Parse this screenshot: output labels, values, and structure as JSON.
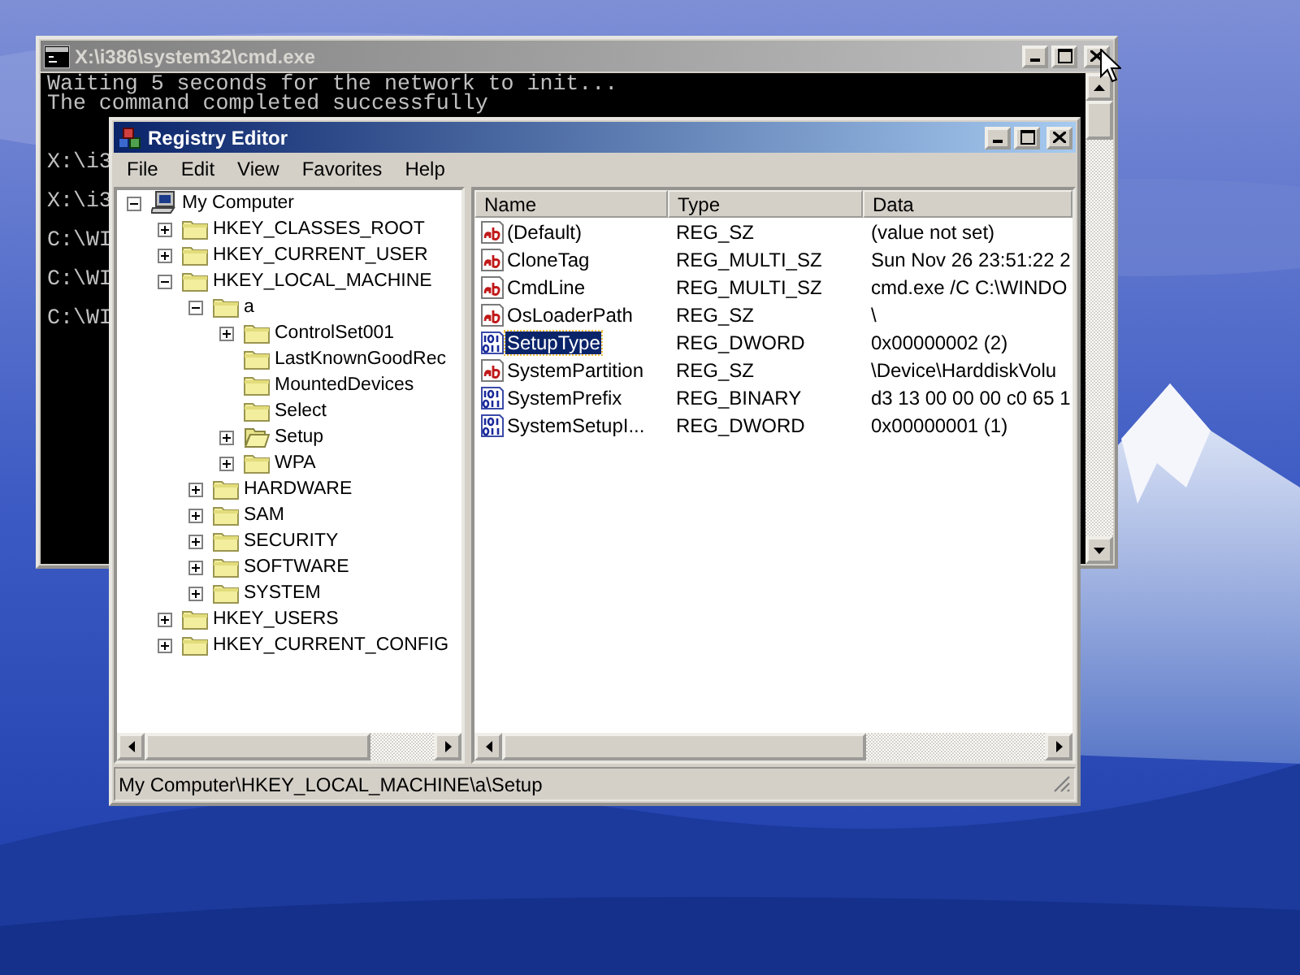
{
  "console_window": {
    "title": "X:\\i386\\system32\\cmd.exe",
    "lines": [
      "Waiting 5 seconds for the network to init...",
      "The command completed successfully",
      "X:\\i3",
      "X:\\i3",
      "C:\\WI",
      "C:\\WI",
      "C:\\WI"
    ]
  },
  "registry_editor": {
    "title": "Registry Editor",
    "menu": [
      "File",
      "Edit",
      "View",
      "Favorites",
      "Help"
    ],
    "tree": [
      {
        "label": "My Computer",
        "kind": "computer",
        "expanded": true,
        "selected": false,
        "children": [
          {
            "label": "HKEY_CLASSES_ROOT",
            "kind": "branch",
            "expanded": false,
            "selected": false
          },
          {
            "label": "HKEY_CURRENT_USER",
            "kind": "branch",
            "expanded": false,
            "selected": false
          },
          {
            "label": "HKEY_LOCAL_MACHINE",
            "kind": "branch",
            "expanded": true,
            "selected": false,
            "children": [
              {
                "label": "a",
                "kind": "branch",
                "expanded": true,
                "selected": false,
                "children": [
                  {
                    "label": "ControlSet001",
                    "kind": "branch",
                    "expanded": false,
                    "selected": false
                  },
                  {
                    "label": "LastKnownGoodRec",
                    "kind": "leaf",
                    "selected": false
                  },
                  {
                    "label": "MountedDevices",
                    "kind": "leaf",
                    "selected": false
                  },
                  {
                    "label": "Select",
                    "kind": "leaf",
                    "selected": false
                  },
                  {
                    "label": "Setup",
                    "kind": "branch",
                    "expanded": false,
                    "selected": true
                  },
                  {
                    "label": "WPA",
                    "kind": "branch",
                    "expanded": false,
                    "selected": false
                  }
                ]
              },
              {
                "label": "HARDWARE",
                "kind": "branch",
                "expanded": false,
                "selected": false
              },
              {
                "label": "SAM",
                "kind": "branch",
                "expanded": false,
                "selected": false
              },
              {
                "label": "SECURITY",
                "kind": "branch",
                "expanded": false,
                "selected": false
              },
              {
                "label": "SOFTWARE",
                "kind": "branch",
                "expanded": false,
                "selected": false
              },
              {
                "label": "SYSTEM",
                "kind": "branch",
                "expanded": false,
                "selected": false
              }
            ]
          },
          {
            "label": "HKEY_USERS",
            "kind": "branch",
            "expanded": false,
            "selected": false
          },
          {
            "label": "HKEY_CURRENT_CONFIG",
            "kind": "branch",
            "expanded": false,
            "selected": false
          }
        ]
      }
    ],
    "columns": [
      "Name",
      "Type",
      "Data"
    ],
    "values": [
      {
        "kind": "string",
        "name": "(Default)",
        "type": "REG_SZ",
        "data": "(value not set)",
        "selected": false
      },
      {
        "kind": "string",
        "name": "CloneTag",
        "type": "REG_MULTI_SZ",
        "data": "Sun Nov 26 23:51:22 2",
        "selected": false
      },
      {
        "kind": "string",
        "name": "CmdLine",
        "type": "REG_MULTI_SZ",
        "data": "cmd.exe /C C:\\WINDO",
        "selected": false
      },
      {
        "kind": "string",
        "name": "OsLoaderPath",
        "type": "REG_SZ",
        "data": "\\",
        "selected": false
      },
      {
        "kind": "binary",
        "name": "SetupType",
        "type": "REG_DWORD",
        "data": "0x00000002 (2)",
        "selected": true
      },
      {
        "kind": "string",
        "name": "SystemPartition",
        "type": "REG_SZ",
        "data": "\\Device\\HarddiskVolu",
        "selected": false
      },
      {
        "kind": "binary",
        "name": "SystemPrefix",
        "type": "REG_BINARY",
        "data": "d3 13 00 00 00 c0 65 1",
        "selected": false
      },
      {
        "kind": "binary",
        "name": "SystemSetupI...",
        "type": "REG_DWORD",
        "data": "0x00000001 (1)",
        "selected": false
      }
    ],
    "status_bar": "My Computer\\HKEY_LOCAL_MACHINE\\a\\Setup"
  }
}
